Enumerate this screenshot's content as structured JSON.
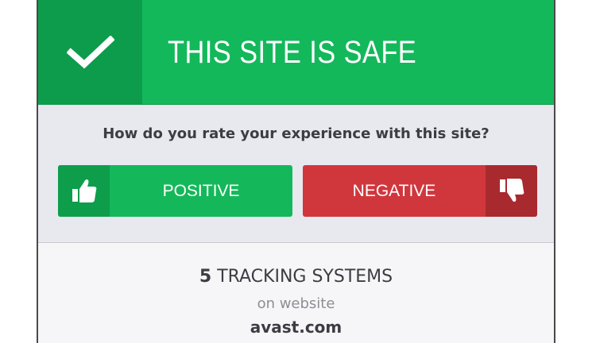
{
  "header": {
    "title": "THIS SITE IS SAFE",
    "icon": "checkmark-icon",
    "accent_color": "#13b85b",
    "accent_dark": "#0d9c4c"
  },
  "rating": {
    "question": "How do you rate your experience with this site?",
    "positive": {
      "label": "POSITIVE",
      "icon": "thumbs-up-icon",
      "color": "#14b85a"
    },
    "negative": {
      "label": "NEGATIVE",
      "icon": "thumbs-down-icon",
      "color": "#d0373d"
    }
  },
  "tracking": {
    "count": "5",
    "label": "TRACKING SYSTEMS",
    "subtitle": "on website",
    "site": "avast.com"
  }
}
